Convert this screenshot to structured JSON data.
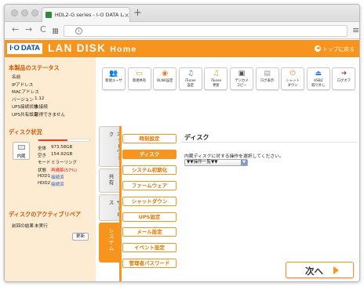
{
  "browser": {
    "tab_title": "HDL2-G series - I-O DATA LA",
    "tab_close": "×",
    "new_tab": "+",
    "back": "←",
    "forward": "→",
    "reload": "C",
    "url_icon": "i",
    "menu": "≡"
  },
  "header": {
    "logo": "I·O DATA",
    "product_name": "LAN DISK",
    "product_home": "Home",
    "top_link": "トップに戻る",
    "top_link_icon": "◀"
  },
  "status": {
    "title": "本製品のステータス",
    "rows": [
      {
        "label": "名前",
        "value": ""
      },
      {
        "label": "IPアドレス",
        "value": ""
      },
      {
        "label": "MACアドレス",
        "value": ""
      },
      {
        "label": "バージョン",
        "value": "1.12"
      },
      {
        "label": "UPS接続状態",
        "value": "未接続"
      },
      {
        "label": "UPS共有設定",
        "value": "取得できません"
      }
    ]
  },
  "disk_status": {
    "title": "ディスク状況",
    "disk_label": "内蔵",
    "usage_fraction": 0.57,
    "rows": [
      {
        "label": "全体",
        "value": "973.58GB",
        "style": ""
      },
      {
        "label": "空き",
        "value": "154.92GB",
        "style": ""
      },
      {
        "label": "モード",
        "value": "ミラーリング",
        "style": ""
      },
      {
        "label": "状態",
        "value": "再構築(57%)",
        "style": "red"
      },
      {
        "label": "HDD1",
        "value": "接続済",
        "style": "blue"
      },
      {
        "label": "HDD2",
        "value": "接続済",
        "style": "blue"
      }
    ]
  },
  "active_repair": {
    "title": "ディスクのアクティブリペア",
    "result_label": "前回の結果",
    "result_value": "未実行",
    "refresh": "更新"
  },
  "toolbar_icons": [
    {
      "name": "add-user-icon",
      "line1": "新規ユーザ",
      "line2": "",
      "glyph": "👥",
      "color": "#c0392b"
    },
    {
      "name": "new-share-icon",
      "line1": "新規共有",
      "line2": "",
      "glyph": "▭",
      "color": "#d4a017"
    },
    {
      "name": "dlna-icon",
      "line1": "DLNA設定",
      "line2": "",
      "glyph": "◉",
      "color": "#e67e22"
    },
    {
      "name": "itunes-settings-icon",
      "line1": "iTunes",
      "line2": "設定",
      "glyph": "♫",
      "color": "#3a7bd5"
    },
    {
      "name": "itunes-update-icon",
      "line1": "iTunes",
      "line2": "更新",
      "glyph": "♫",
      "color": "#d4a017"
    },
    {
      "name": "camera-copy-icon",
      "line1": "デジカメ",
      "line2": "コピー",
      "glyph": "▣",
      "color": "#555"
    },
    {
      "name": "log-view-icon",
      "line1": "ログ表示",
      "line2": "",
      "glyph": "▤",
      "color": "#999"
    },
    {
      "name": "shutdown-icon",
      "line1": "シャット",
      "line2": "ダウン",
      "glyph": "⏻",
      "color": "#e67e22"
    },
    {
      "name": "usb-eject-icon",
      "line1": "USB2",
      "line2": "取り外し",
      "glyph": "⏏",
      "color": "#3a7bd5"
    },
    {
      "name": "logout-icon",
      "line1": "ログオフ",
      "line2": "",
      "glyph": "➜",
      "color": "#c0392b"
    }
  ],
  "vtabs": [
    {
      "name": "tab-network",
      "label": "ネットワーク",
      "active": false
    },
    {
      "name": "tab-share",
      "label": "共有",
      "active": false
    },
    {
      "name": "tab-service",
      "label": "サービス",
      "active": false
    },
    {
      "name": "tab-system",
      "label": "システム",
      "active": true
    }
  ],
  "menu": [
    {
      "name": "menu-time-settings",
      "label": "時刻設定",
      "active": false
    },
    {
      "name": "menu-disk",
      "label": "ディスク",
      "active": true
    },
    {
      "name": "menu-system-init",
      "label": "システム初期化",
      "active": false
    },
    {
      "name": "menu-firmware",
      "label": "ファームウェア",
      "active": false
    },
    {
      "name": "menu-shutdown",
      "label": "シャットダウン",
      "active": false
    },
    {
      "name": "menu-ups",
      "label": "UPS設定",
      "active": false
    },
    {
      "name": "menu-mail",
      "label": "メール設定",
      "active": false
    },
    {
      "name": "menu-event",
      "label": "イベント設定",
      "active": false
    },
    {
      "name": "menu-admin-password",
      "label": "管理者パスワード",
      "active": false
    }
  ],
  "content": {
    "title": "ディスク",
    "description": "内蔵ディスクに対する操作を選択してください。",
    "select_value": "▼▼操作一覧▼▼",
    "select_arrow": "▼",
    "next_button": "次へ"
  },
  "colors": {
    "accent": "#f7941d",
    "panel_bg": "#fdecd2",
    "section_title": "#d35400",
    "logo_text": "#0a47a0"
  }
}
